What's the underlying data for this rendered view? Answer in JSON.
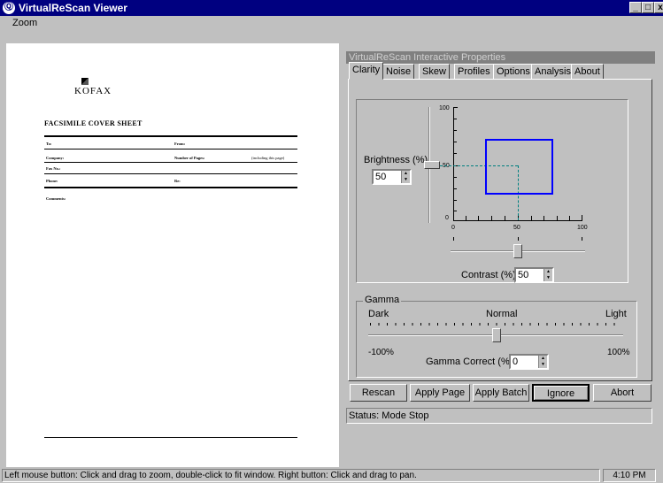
{
  "window": {
    "title": "VirtualReScan Viewer",
    "min": "_",
    "max": "□",
    "close": "x"
  },
  "menu": {
    "zoom": "Zoom"
  },
  "document": {
    "logo_text": "KOFAX",
    "heading": "Facsimile Cover Sheet",
    "fields": {
      "to": "To:",
      "from": "From:",
      "company": "Company:",
      "pages": "Number of Pages:",
      "pages_note": "(including this page)",
      "fax": "Fax No.:",
      "phone": "Phone:",
      "re": "Re:",
      "comments": "Comments:"
    }
  },
  "properties": {
    "title": "VirtualReScan Interactive Properties",
    "tabs": [
      "Clarity",
      "Noise",
      "Skew",
      "Profiles",
      "Options",
      "Analysis",
      "About"
    ],
    "active_tab": "Clarity",
    "brightness": {
      "label": "Brightness (%):",
      "value": "50"
    },
    "contrast": {
      "label": "Contrast (%):",
      "value": "50"
    },
    "axis": {
      "y_top": "100",
      "y_mid": "50",
      "origin": "0",
      "x_mid": "50",
      "x_max": "100"
    },
    "gamma": {
      "title": "Gamma",
      "dark": "Dark",
      "normal": "Normal",
      "light": "Light",
      "min": "-100%",
      "max": "100%",
      "correct_label": "Gamma Correct (%):",
      "value": "0"
    },
    "buttons": {
      "rescan": "Rescan",
      "apply_page": "Apply Page",
      "apply_batch": "Apply Batch",
      "ignore": "Ignore",
      "abort": "Abort"
    },
    "status": "Status: Mode Stop",
    "box_color": "#0000ff",
    "dash_color": "#008080"
  },
  "statusbar": {
    "message": "Left mouse button: Click and drag to zoom, double-click to fit window.  Right button: Click and drag to pan.",
    "time": "4:10 PM"
  }
}
